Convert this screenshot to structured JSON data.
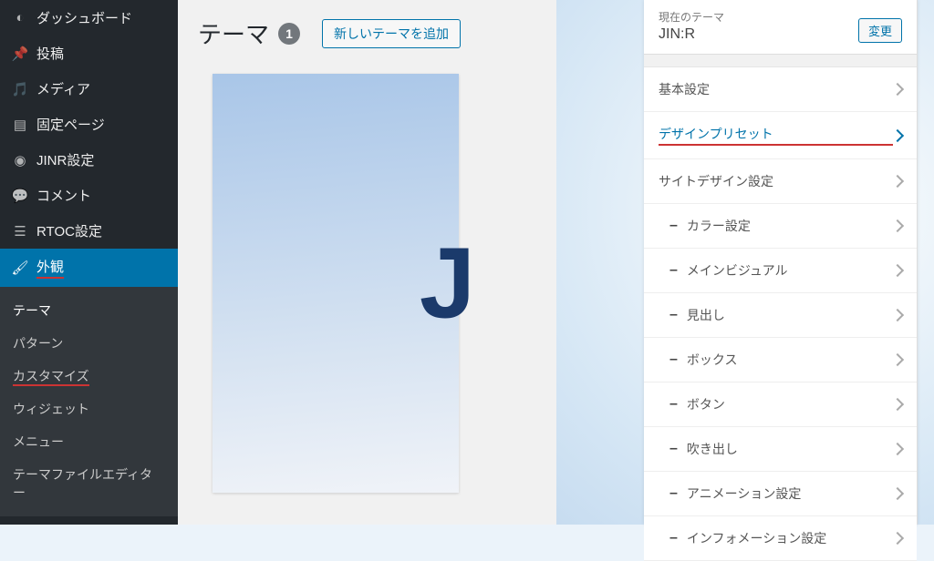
{
  "sidebar": {
    "items": [
      {
        "label": "ダッシュボード",
        "icon": "dashboard"
      },
      {
        "label": "投稿",
        "icon": "pin"
      },
      {
        "label": "メディア",
        "icon": "media"
      },
      {
        "label": "固定ページ",
        "icon": "page"
      },
      {
        "label": "JINR設定",
        "icon": "globe"
      },
      {
        "label": "コメント",
        "icon": "comment"
      },
      {
        "label": "RTOC設定",
        "icon": "list"
      },
      {
        "label": "外観",
        "icon": "brush",
        "active": true,
        "underline": true
      }
    ],
    "submenu": [
      {
        "label": "テーマ",
        "current": true
      },
      {
        "label": "パターン"
      },
      {
        "label": "カスタマイズ",
        "underline": true
      },
      {
        "label": "ウィジェット"
      },
      {
        "label": "メニュー"
      },
      {
        "label": "テーマファイルエディター"
      }
    ]
  },
  "header": {
    "title": "テーマ",
    "count": "1",
    "add_button": "新しいテーマを追加"
  },
  "theme_tile": {
    "letter": "J"
  },
  "customizer": {
    "head": {
      "label": "現在のテーマ",
      "name": "JIN:R",
      "change": "変更"
    },
    "rows": [
      {
        "type": "top",
        "label": "基本設定"
      },
      {
        "type": "top",
        "label": "デザインプリセット",
        "active": true,
        "underline": true
      },
      {
        "type": "top",
        "label": "サイトデザイン設定"
      },
      {
        "type": "sub",
        "label": "カラー設定"
      },
      {
        "type": "sub",
        "label": "メインビジュアル"
      },
      {
        "type": "sub",
        "label": "見出し"
      },
      {
        "type": "sub",
        "label": "ボックス"
      },
      {
        "type": "sub",
        "label": "ボタン"
      },
      {
        "type": "sub",
        "label": "吹き出し"
      },
      {
        "type": "sub",
        "label": "アニメーション設定"
      },
      {
        "type": "sub",
        "label": "インフォメーション設定"
      }
    ]
  }
}
